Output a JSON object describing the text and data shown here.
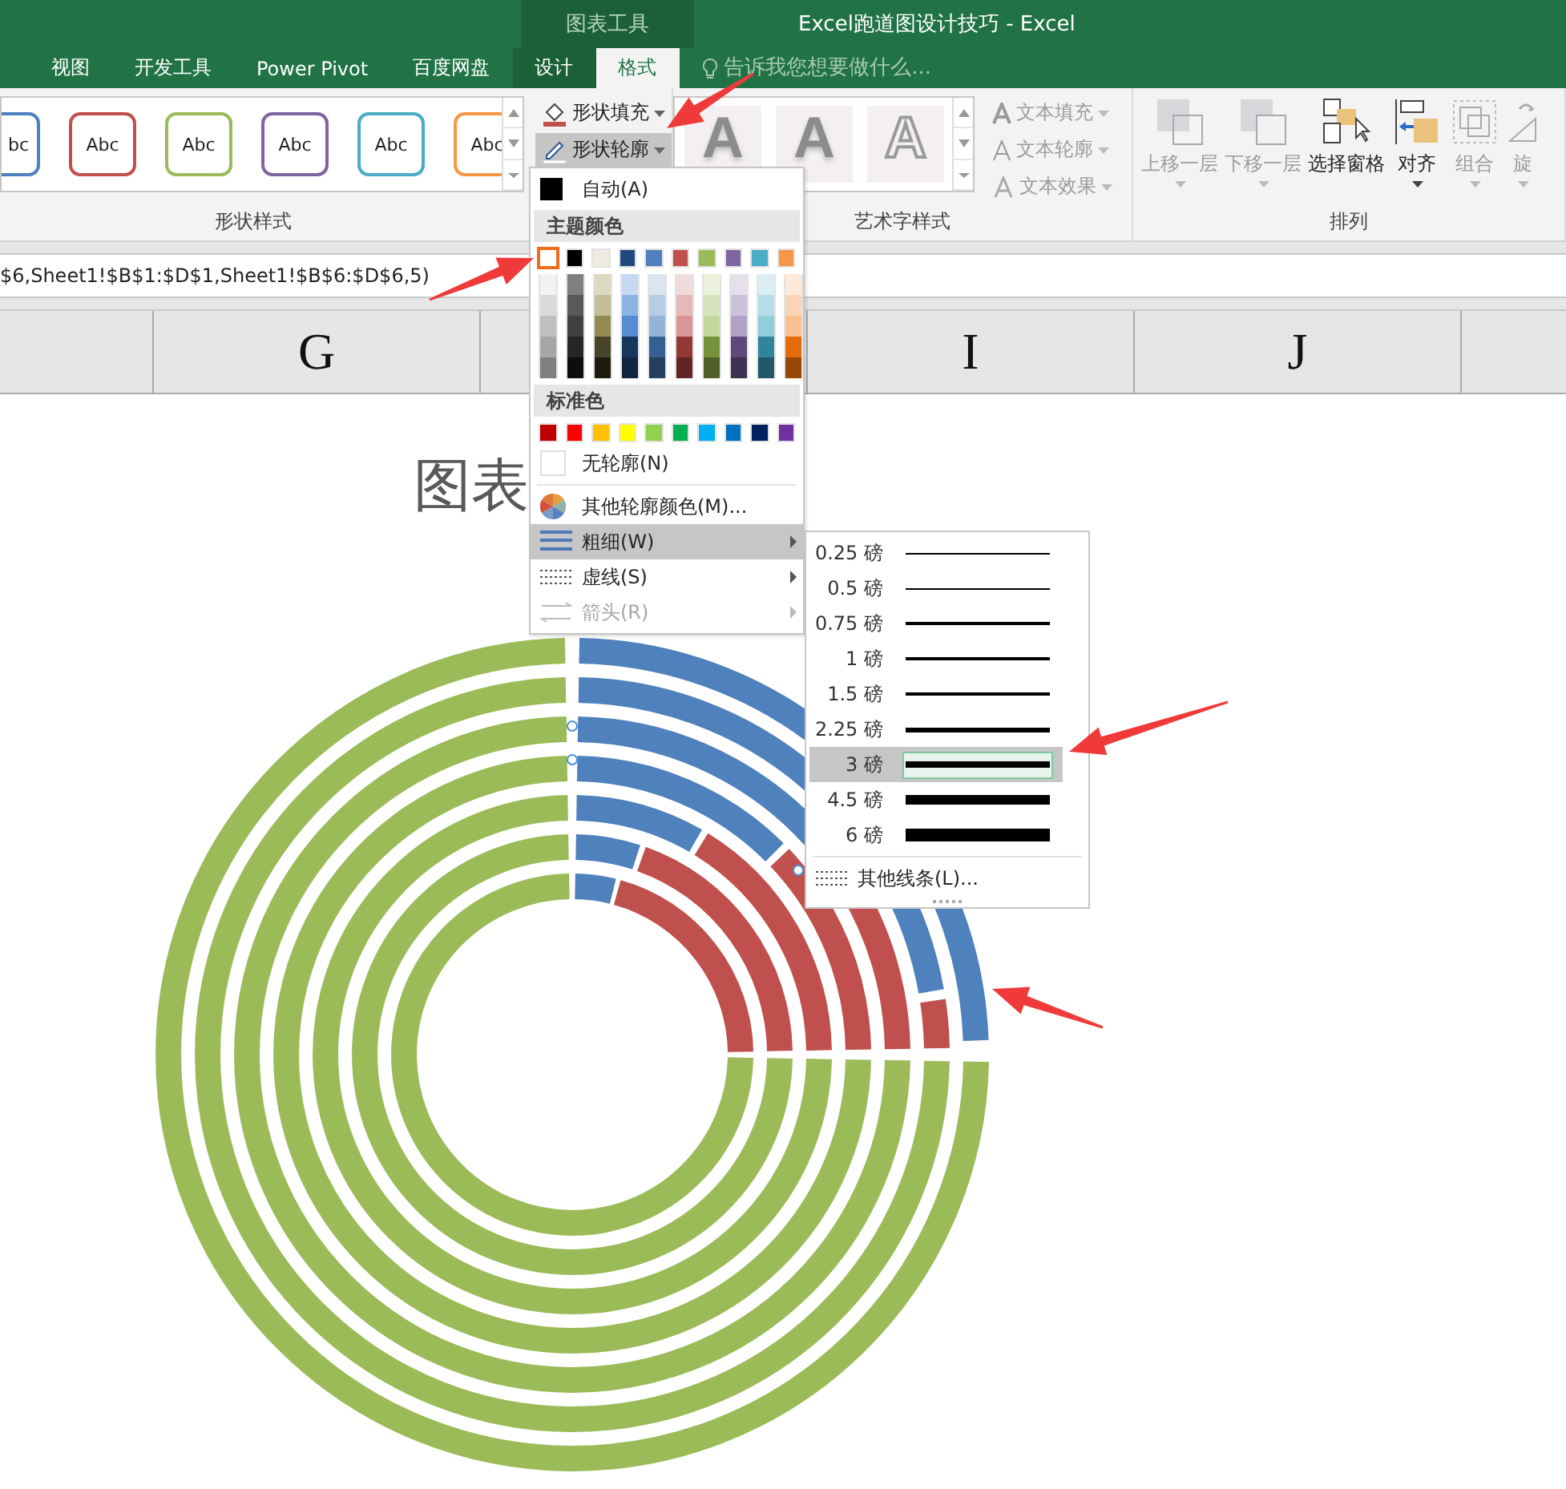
{
  "title_bar": {
    "context_group": "图表工具",
    "title": "Excel跑道图设计技巧 - Excel"
  },
  "tabs": [
    {
      "label": "视图",
      "selected": false,
      "contextual": false
    },
    {
      "label": "开发工具",
      "selected": false,
      "contextual": false
    },
    {
      "label": "Power Pivot",
      "selected": false,
      "contextual": false
    },
    {
      "label": "百度网盘",
      "selected": false,
      "contextual": false
    },
    {
      "label": "设计",
      "selected": false,
      "contextual": true
    },
    {
      "label": "格式",
      "selected": true,
      "contextual": true
    }
  ],
  "tell_me": {
    "placeholder": "告诉我您想要做什么..."
  },
  "shape_styles": {
    "label": "形状样式",
    "gallery": [
      {
        "label": "bc",
        "color": "#4f81bd"
      },
      {
        "label": "Abc",
        "color": "#c0504d"
      },
      {
        "label": "Abc",
        "color": "#9bbb59"
      },
      {
        "label": "Abc",
        "color": "#8064a2"
      },
      {
        "label": "Abc",
        "color": "#4bacc6"
      },
      {
        "label": "Abc",
        "color": "#f79646"
      }
    ],
    "buttons": [
      {
        "kind": "fill",
        "label": "形状填充",
        "pressed": false
      },
      {
        "kind": "outline",
        "label": "形状轮廓",
        "pressed": true
      }
    ]
  },
  "wordart_styles": {
    "label": "艺术字样式",
    "gallery": [
      {
        "kind": "filled",
        "label": "A"
      },
      {
        "kind": "filled",
        "label": "A"
      },
      {
        "kind": "outline",
        "label": "A"
      }
    ],
    "buttons": [
      {
        "kind": "fill",
        "label": "文本填充",
        "disabled": true
      },
      {
        "kind": "outline",
        "label": "文本轮廓",
        "disabled": true
      },
      {
        "kind": "effect",
        "label": "文本效果",
        "disabled": true
      }
    ]
  },
  "arrange": {
    "label": "排列",
    "buttons": [
      {
        "kind": "bring-forward",
        "label": "上移一层",
        "disabled": true
      },
      {
        "kind": "send-backward",
        "label": "下移一层",
        "disabled": true
      },
      {
        "kind": "selection-pane",
        "label": "选择窗格",
        "disabled": false
      },
      {
        "kind": "align",
        "label": "对齐",
        "disabled": false
      },
      {
        "kind": "group",
        "label": "组合",
        "disabled": true
      },
      {
        "kind": "rotate",
        "label": "旋",
        "disabled": true
      }
    ]
  },
  "formula_bar": {
    "value": "$6,Sheet1!$B$1:$D$1,Sheet1!$B$6:$D$6,5)"
  },
  "columns": [
    {
      "label": "G"
    },
    {
      "label": "I"
    },
    {
      "label": "J"
    }
  ],
  "chart": {
    "title": "图表"
  },
  "outline_menu": {
    "auto": {
      "label": "自动(A)"
    },
    "theme_header": "主题颜色",
    "theme_colors": [
      {
        "color": "#ffffff",
        "selected": true,
        "shades": [
          {
            "color": "#f2f2f2"
          },
          {
            "color": "#d9d9d9"
          },
          {
            "color": "#bfbfbf"
          },
          {
            "color": "#a6a6a6"
          },
          {
            "color": "#808080"
          }
        ]
      },
      {
        "color": "#000000",
        "selected": false,
        "shades": [
          {
            "color": "#7f7f7f"
          },
          {
            "color": "#595959"
          },
          {
            "color": "#404040"
          },
          {
            "color": "#262626"
          },
          {
            "color": "#0d0d0d"
          }
        ]
      },
      {
        "color": "#eeece1",
        "selected": false,
        "shades": [
          {
            "color": "#ddd9c3"
          },
          {
            "color": "#c4bd97"
          },
          {
            "color": "#938953"
          },
          {
            "color": "#494429"
          },
          {
            "color": "#1d1b10"
          }
        ]
      },
      {
        "color": "#1f497d",
        "selected": false,
        "shades": [
          {
            "color": "#c6d9f0"
          },
          {
            "color": "#8db3e2"
          },
          {
            "color": "#548dd4"
          },
          {
            "color": "#17365d"
          },
          {
            "color": "#0f243e"
          }
        ]
      },
      {
        "color": "#4f81bd",
        "selected": false,
        "shades": [
          {
            "color": "#dbe5f1"
          },
          {
            "color": "#b8cce4"
          },
          {
            "color": "#95b3d7"
          },
          {
            "color": "#366092"
          },
          {
            "color": "#244061"
          }
        ]
      },
      {
        "color": "#c0504d",
        "selected": false,
        "shades": [
          {
            "color": "#f2dcdb"
          },
          {
            "color": "#e5b9b7"
          },
          {
            "color": "#d99694"
          },
          {
            "color": "#953734"
          },
          {
            "color": "#632423"
          }
        ]
      },
      {
        "color": "#9bbb59",
        "selected": false,
        "shades": [
          {
            "color": "#ebf1dd"
          },
          {
            "color": "#d7e3bc"
          },
          {
            "color": "#c3d69b"
          },
          {
            "color": "#76923c"
          },
          {
            "color": "#4f6128"
          }
        ]
      },
      {
        "color": "#8064a2",
        "selected": false,
        "shades": [
          {
            "color": "#e5e0ec"
          },
          {
            "color": "#ccc1d9"
          },
          {
            "color": "#b2a2c7"
          },
          {
            "color": "#5f497a"
          },
          {
            "color": "#3f3151"
          }
        ]
      },
      {
        "color": "#4bacc6",
        "selected": false,
        "shades": [
          {
            "color": "#dbeef3"
          },
          {
            "color": "#b7dde8"
          },
          {
            "color": "#92cddc"
          },
          {
            "color": "#31859b"
          },
          {
            "color": "#205867"
          }
        ]
      },
      {
        "color": "#f79646",
        "selected": false,
        "shades": [
          {
            "color": "#fdeada"
          },
          {
            "color": "#fbd5b5"
          },
          {
            "color": "#fac08f"
          },
          {
            "color": "#e36c09"
          },
          {
            "color": "#974806"
          }
        ]
      }
    ],
    "standard_header": "标准色",
    "standard_colors": [
      {
        "color": "#c00000",
        "selected": false
      },
      {
        "color": "#ff0000",
        "selected": false
      },
      {
        "color": "#ffc000",
        "selected": false
      },
      {
        "color": "#ffff00",
        "selected": false
      },
      {
        "color": "#92d050",
        "selected": false
      },
      {
        "color": "#00b050",
        "selected": false
      },
      {
        "color": "#00b0f0",
        "selected": false
      },
      {
        "color": "#0070c0",
        "selected": false
      },
      {
        "color": "#002060",
        "selected": false
      },
      {
        "color": "#7030a0",
        "selected": false
      }
    ],
    "items": [
      {
        "kind": "none",
        "label": "无轮廓(N)",
        "selected": false,
        "disabled": false,
        "submenu": false
      },
      {
        "kind": "more-colors",
        "label": "其他轮廓颜色(M)...",
        "selected": false,
        "disabled": false,
        "submenu": false
      },
      {
        "kind": "weight",
        "label": "粗细(W)",
        "selected": true,
        "disabled": false,
        "submenu": true
      },
      {
        "kind": "dash",
        "label": "虚线(S)",
        "selected": false,
        "disabled": false,
        "submenu": true
      },
      {
        "kind": "arrows",
        "label": "箭头(R)",
        "selected": false,
        "disabled": true,
        "submenu": true
      }
    ]
  },
  "weight_menu": {
    "items": [
      {
        "label": "0.25 磅",
        "selected": false
      },
      {
        "label": "0.5 磅",
        "selected": false
      },
      {
        "label": "0.75 磅",
        "selected": false
      },
      {
        "label": "1 磅",
        "selected": false
      },
      {
        "label": "1.5 磅",
        "selected": false
      },
      {
        "label": "2.25 磅",
        "selected": false
      },
      {
        "label": "3 磅",
        "selected": true
      },
      {
        "label": "4.5 磅",
        "selected": false
      },
      {
        "label": "6 磅",
        "selected": false
      }
    ],
    "more": "其他线条(L)..."
  }
}
